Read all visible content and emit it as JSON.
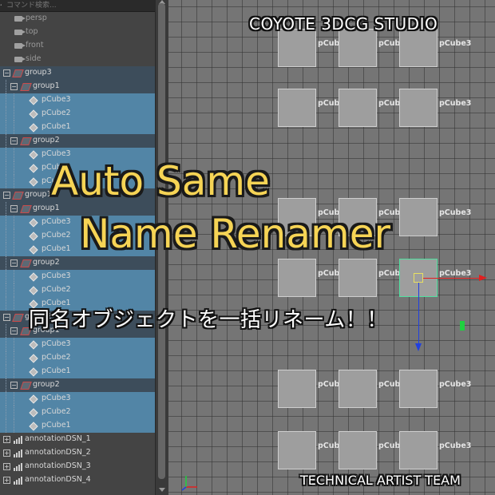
{
  "outliner": {
    "search_placeholder": "コマンド検索...",
    "cameras": [
      "persp",
      "top",
      "front",
      "side"
    ],
    "groups": [
      {
        "name": "group3",
        "children": [
          {
            "name": "group1",
            "items": [
              "pCube3",
              "pCube2",
              "pCube1"
            ]
          },
          {
            "name": "group2",
            "items": [
              "pCube3",
              "pCube2",
              "pCube1"
            ]
          }
        ]
      },
      {
        "name": "group1",
        "children": [
          {
            "name": "group1",
            "items": [
              "pCube3",
              "pCube2",
              "pCube1"
            ]
          },
          {
            "name": "group2",
            "items": [
              "pCube3",
              "pCube2",
              "pCube1"
            ]
          }
        ]
      },
      {
        "name": "group2",
        "children": [
          {
            "name": "group1",
            "items": [
              "pCube3",
              "pCube2",
              "pCube1"
            ]
          },
          {
            "name": "group2",
            "items": [
              "pCube3",
              "pCube2",
              "pCube1"
            ]
          }
        ]
      }
    ],
    "annotations": [
      "annotationDSN_1",
      "annotationDSN_2",
      "annotationDSN_3",
      "annotationDSN_4"
    ]
  },
  "viewport": {
    "cube_labels": [
      "pCube1",
      "pCube2",
      "pCube3"
    ],
    "selected_cube": "pCube3",
    "colors": {
      "background": "#757575",
      "cube": "#9e9e9e",
      "selection": "#50e0a0",
      "x_axis": "#e02020",
      "y_axis": "#2040e0"
    }
  },
  "overlay": {
    "studio": "COYOTE 3DCG STUDIO",
    "title_line1": "Auto Same",
    "title_line2": "Name Renamer",
    "subtitle": "同名オブジェクトを一括リネーム！！",
    "team": "TECHNICAL ARTIST TEAM",
    "title_color": "#f6d455"
  }
}
